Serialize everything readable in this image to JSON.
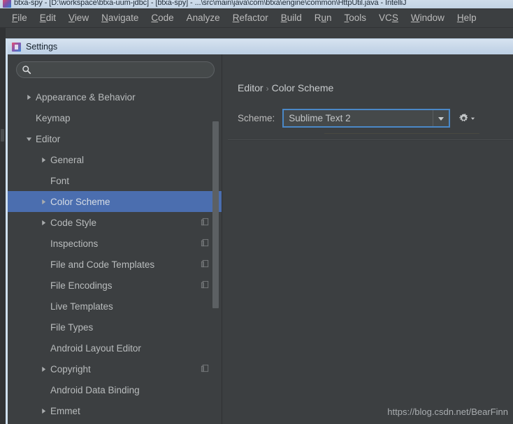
{
  "window": {
    "title": "btxa-spy - [D:\\workspace\\btxa-uum-jdbc] - [btxa-spy] - ...\\src\\main\\java\\com\\btxa\\engine\\common\\HttpUtil.java - IntelliJ",
    "app_icon": "intellij-idea-icon"
  },
  "menubar": {
    "items": [
      {
        "label": "File",
        "mnemonic": "F"
      },
      {
        "label": "Edit",
        "mnemonic": "E"
      },
      {
        "label": "View",
        "mnemonic": "V"
      },
      {
        "label": "Navigate",
        "mnemonic": "N"
      },
      {
        "label": "Code",
        "mnemonic": "C"
      },
      {
        "label": "Analyze",
        "mnemonic": ""
      },
      {
        "label": "Refactor",
        "mnemonic": "R"
      },
      {
        "label": "Build",
        "mnemonic": "B"
      },
      {
        "label": "Run",
        "mnemonic": "u"
      },
      {
        "label": "Tools",
        "mnemonic": "T"
      },
      {
        "label": "VCS",
        "mnemonic": "S"
      },
      {
        "label": "Window",
        "mnemonic": "W"
      },
      {
        "label": "Help",
        "mnemonic": "H"
      }
    ]
  },
  "dialog": {
    "title": "Settings",
    "icon": "intellij-idea-icon"
  },
  "search": {
    "value": "",
    "placeholder": "",
    "icon": "search-icon"
  },
  "tree": {
    "items": [
      {
        "label": "Appearance & Behavior",
        "indent": 1,
        "arrow": "collapsed",
        "selected": false,
        "badge": false
      },
      {
        "label": "Keymap",
        "indent": 1,
        "arrow": "none",
        "selected": false,
        "badge": false
      },
      {
        "label": "Editor",
        "indent": 1,
        "arrow": "expanded",
        "selected": false,
        "badge": false
      },
      {
        "label": "General",
        "indent": 2,
        "arrow": "collapsed",
        "selected": false,
        "badge": false
      },
      {
        "label": "Font",
        "indent": 2,
        "arrow": "none",
        "selected": false,
        "badge": false
      },
      {
        "label": "Color Scheme",
        "indent": 2,
        "arrow": "collapsed",
        "selected": true,
        "badge": false
      },
      {
        "label": "Code Style",
        "indent": 2,
        "arrow": "collapsed",
        "selected": false,
        "badge": true
      },
      {
        "label": "Inspections",
        "indent": 2,
        "arrow": "none",
        "selected": false,
        "badge": true
      },
      {
        "label": "File and Code Templates",
        "indent": 2,
        "arrow": "none",
        "selected": false,
        "badge": true
      },
      {
        "label": "File Encodings",
        "indent": 2,
        "arrow": "none",
        "selected": false,
        "badge": true
      },
      {
        "label": "Live Templates",
        "indent": 2,
        "arrow": "none",
        "selected": false,
        "badge": false
      },
      {
        "label": "File Types",
        "indent": 2,
        "arrow": "none",
        "selected": false,
        "badge": false
      },
      {
        "label": "Android Layout Editor",
        "indent": 2,
        "arrow": "none",
        "selected": false,
        "badge": false
      },
      {
        "label": "Copyright",
        "indent": 2,
        "arrow": "collapsed",
        "selected": false,
        "badge": true
      },
      {
        "label": "Android Data Binding",
        "indent": 2,
        "arrow": "none",
        "selected": false,
        "badge": false
      },
      {
        "label": "Emmet",
        "indent": 2,
        "arrow": "collapsed",
        "selected": false,
        "badge": false
      }
    ]
  },
  "content": {
    "breadcrumb": {
      "parent": "Editor",
      "separator": "›",
      "current": "Color Scheme"
    },
    "scheme": {
      "label": "Scheme:",
      "value": "Sublime Text 2",
      "dropdown_icon": "chevron-down-icon",
      "gear_icon": "gear-icon",
      "gear_dropdown_icon": "chevron-down-icon"
    }
  },
  "watermark": {
    "text": "https://blog.csdn.net/BearFinn"
  },
  "colors": {
    "background": "#3c3f41",
    "selection": "#4b6eaf",
    "focus_border": "#4a88c7",
    "text": "#bbbbbb",
    "dialog_titlebar": "#c6d6e8"
  }
}
